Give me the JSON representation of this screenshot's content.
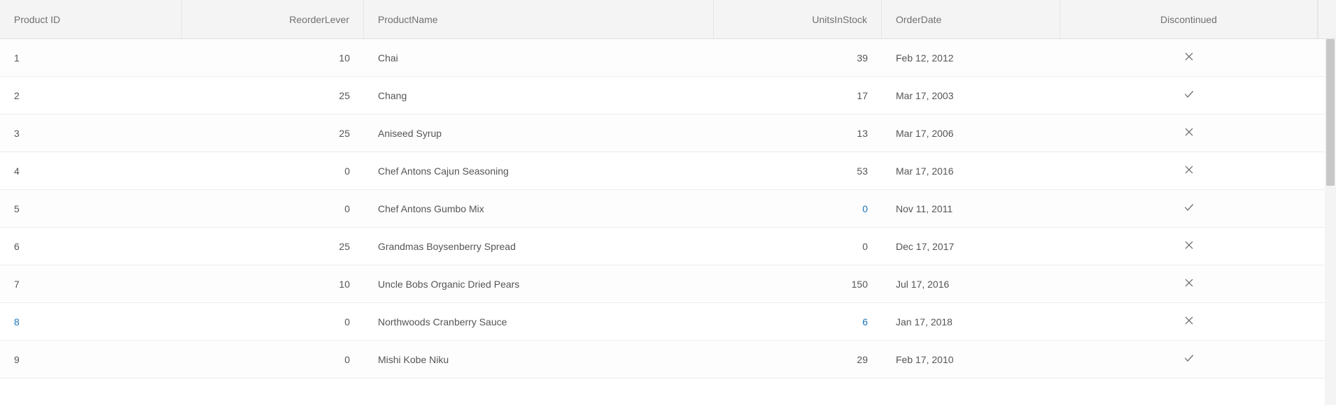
{
  "columns": {
    "productId": "Product ID",
    "reorderLevel": "ReorderLever",
    "productName": "ProductName",
    "unitsInStock": "UnitsInStock",
    "orderDate": "OrderDate",
    "discontinued": "Discontinued"
  },
  "rows": [
    {
      "productId": "1",
      "reorderLevel": "10",
      "productName": "Chai",
      "unitsInStock": "39",
      "orderDate": "Feb 12, 2012",
      "discontinued": false,
      "idLink": false,
      "unitsLink": false
    },
    {
      "productId": "2",
      "reorderLevel": "25",
      "productName": "Chang",
      "unitsInStock": "17",
      "orderDate": "Mar 17, 2003",
      "discontinued": true,
      "idLink": false,
      "unitsLink": false
    },
    {
      "productId": "3",
      "reorderLevel": "25",
      "productName": "Aniseed Syrup",
      "unitsInStock": "13",
      "orderDate": "Mar 17, 2006",
      "discontinued": false,
      "idLink": false,
      "unitsLink": false
    },
    {
      "productId": "4",
      "reorderLevel": "0",
      "productName": "Chef Antons Cajun Seasoning",
      "unitsInStock": "53",
      "orderDate": "Mar 17, 2016",
      "discontinued": false,
      "idLink": false,
      "unitsLink": false
    },
    {
      "productId": "5",
      "reorderLevel": "0",
      "productName": "Chef Antons Gumbo Mix",
      "unitsInStock": "0",
      "orderDate": "Nov 11, 2011",
      "discontinued": true,
      "idLink": false,
      "unitsLink": true
    },
    {
      "productId": "6",
      "reorderLevel": "25",
      "productName": "Grandmas Boysenberry Spread",
      "unitsInStock": "0",
      "orderDate": "Dec 17, 2017",
      "discontinued": false,
      "idLink": false,
      "unitsLink": false
    },
    {
      "productId": "7",
      "reorderLevel": "10",
      "productName": "Uncle Bobs Organic Dried Pears",
      "unitsInStock": "150",
      "orderDate": "Jul 17, 2016",
      "discontinued": false,
      "idLink": false,
      "unitsLink": false
    },
    {
      "productId": "8",
      "reorderLevel": "0",
      "productName": "Northwoods Cranberry Sauce",
      "unitsInStock": "6",
      "orderDate": "Jan 17, 2018",
      "discontinued": false,
      "idLink": true,
      "unitsLink": true
    },
    {
      "productId": "9",
      "reorderLevel": "0",
      "productName": "Mishi Kobe Niku",
      "unitsInStock": "29",
      "orderDate": "Feb 17, 2010",
      "discontinued": true,
      "idLink": false,
      "unitsLink": false
    }
  ]
}
